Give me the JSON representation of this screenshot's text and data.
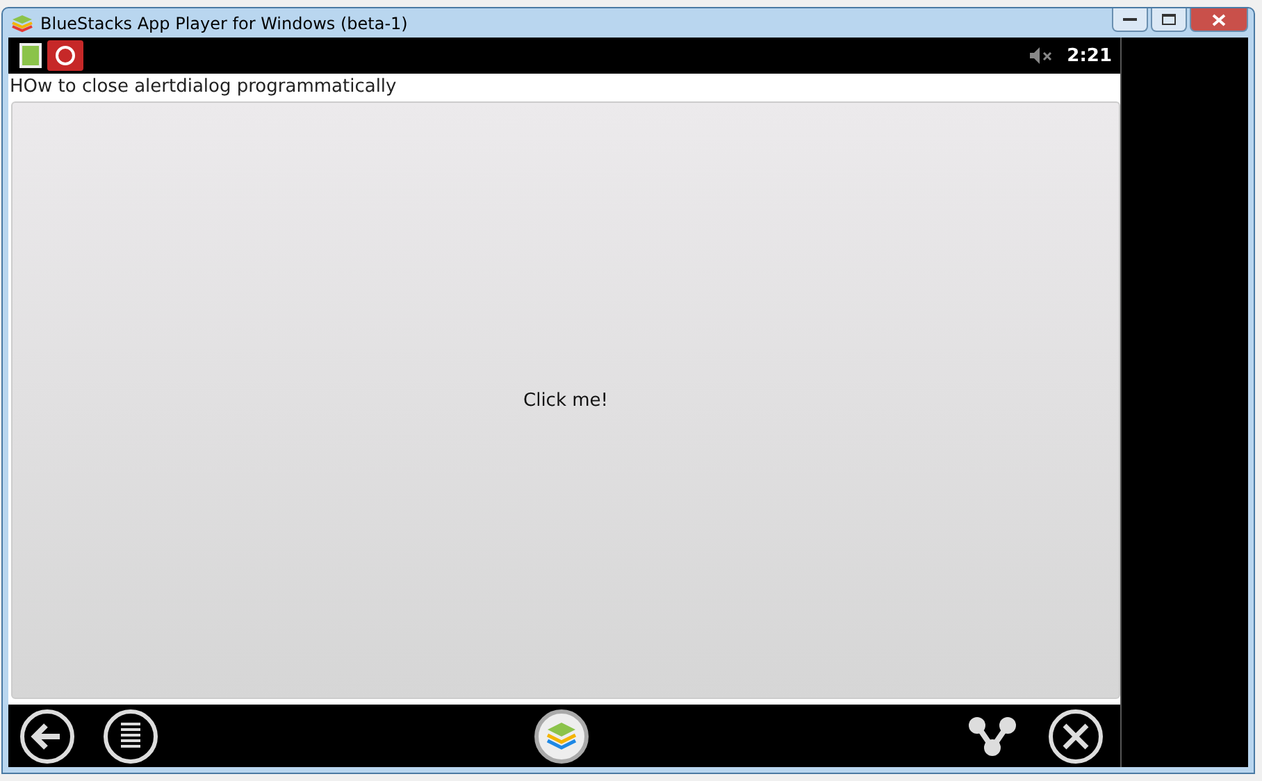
{
  "window": {
    "title": "BlueStacks App Player for Windows (beta-1)"
  },
  "status_bar": {
    "time": "2:21"
  },
  "app": {
    "title": "HOw to close alertdialog programmatically",
    "button": {
      "label": "Click me!"
    }
  }
}
